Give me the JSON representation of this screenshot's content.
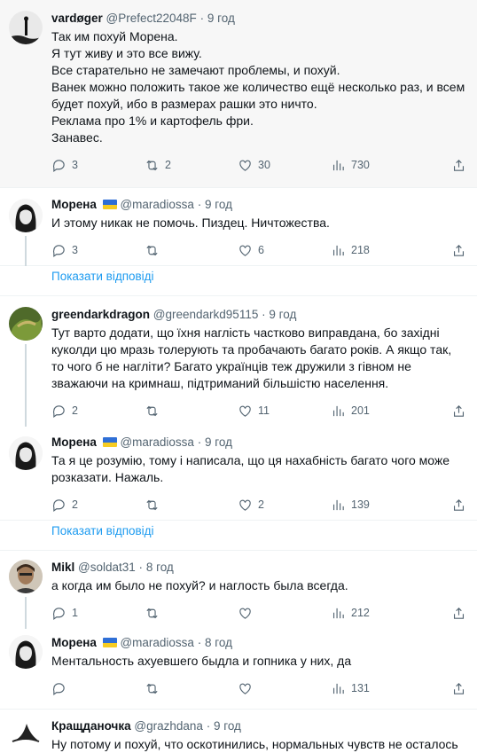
{
  "tweets": [
    {
      "name": "vardøger",
      "handle": "@Prefect22048F",
      "time": "9 год",
      "flag": false,
      "lines": [
        "Так им похуй Морена.",
        "Я тут живу и это все вижу.",
        "Все старательно не замечают проблемы, и похуй.",
        "Ванек можно положить такое же количество ещё несколько раз, и всем будет похуй, ибо в размерах рашки это ничто.",
        "Реклама про 1% и картофель фри.",
        "Занавес."
      ],
      "replies": "3",
      "retweets": "2",
      "likes": "30",
      "views": "730"
    },
    {
      "name": "Морена",
      "handle": "@maradiossa",
      "time": "9 год",
      "flag": true,
      "lines": [
        "И этому никак не помочь. Пиздец. Ничтожества."
      ],
      "replies": "3",
      "retweets": "",
      "likes": "6",
      "views": "218"
    },
    {
      "name": "greendarkdragon",
      "handle": "@greendarkd95115",
      "time": "9 год",
      "flag": false,
      "lines": [
        "Тут варто додати, що їхня нагліcть частково виправдана, бо західні куколди цю мразь толерують та пробачають багато років. А якщо так, то чого б не нагліти? Багато українців теж дружили з гівном не зважаючи на кримнаш, підтриманий більшістю населення."
      ],
      "replies": "2",
      "retweets": "",
      "likes": "11",
      "views": "201"
    },
    {
      "name": "Морена",
      "handle": "@maradiossa",
      "time": "9 год",
      "flag": true,
      "lines": [
        "Та я це розумію, тому і написала, що ця нахабність багато чого може розказати. Нажаль."
      ],
      "replies": "2",
      "retweets": "",
      "likes": "2",
      "views": "139"
    },
    {
      "name": "Mikl",
      "handle": "@soldat31",
      "time": "8 год",
      "flag": false,
      "lines": [
        "а когда им было не похуй? и наглость была всегда."
      ],
      "replies": "1",
      "retweets": "",
      "likes": "",
      "views": "212"
    },
    {
      "name": "Морена",
      "handle": "@maradiossa",
      "time": "8 год",
      "flag": true,
      "lines": [
        "Ментальность ахуевшего быдла и гопника у них, да"
      ],
      "replies": "",
      "retweets": "",
      "likes": "",
      "views": "131"
    },
    {
      "name": "Кращданочка",
      "handle": "@grazhdana",
      "time": "9 год",
      "flag": false,
      "lines": [
        "Ну потому и похуй, что оскотинились, нормальных чувств не осталось"
      ],
      "replies": "",
      "retweets": "",
      "likes": "",
      "views": ""
    }
  ],
  "show_replies": "Показати відповіді",
  "dot": "·"
}
